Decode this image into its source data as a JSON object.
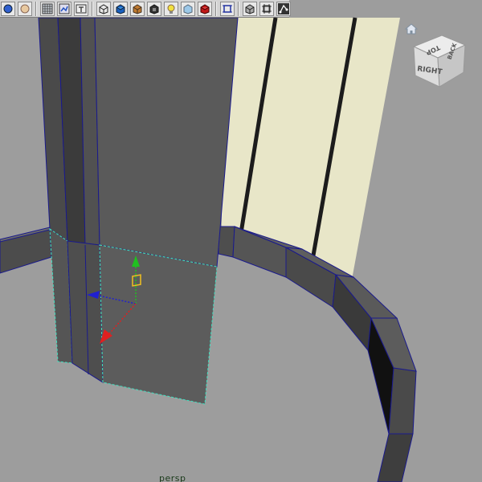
{
  "toolbar": {
    "buttons": [
      {
        "id": "select-mode",
        "icon": "select-mode-icon"
      },
      {
        "id": "snap-mode",
        "icon": "snap-circle-icon"
      },
      {
        "id": "wireframe-grid",
        "icon": "grid-icon"
      },
      {
        "id": "image-plane",
        "icon": "image-plane-icon"
      },
      {
        "id": "text-camera",
        "icon": "camera-attributes-icon"
      },
      {
        "id": "wireframe-shading",
        "icon": "wireframe-cube-icon"
      },
      {
        "id": "smooth-shading",
        "icon": "smooth-shade-icon"
      },
      {
        "id": "textured-shading",
        "icon": "textured-cube-icon"
      },
      {
        "id": "x-ray",
        "icon": "xray-icon"
      },
      {
        "id": "use-all-lights",
        "icon": "light-bulb-icon"
      },
      {
        "id": "shadows",
        "icon": "shadow-cube-icon"
      },
      {
        "id": "screen-space-ao",
        "icon": "red-cube-icon"
      },
      {
        "id": "isolate-select",
        "icon": "isolate-select-icon"
      },
      {
        "id": "xray-joints",
        "icon": "xray-joints-icon"
      },
      {
        "id": "resolution-gate",
        "icon": "resolution-gate-icon"
      },
      {
        "id": "component-display",
        "icon": "component-display-icon"
      }
    ]
  },
  "viewcube": {
    "face_front": "RIGHT",
    "face_top": "TOP",
    "face_side": "BACK"
  },
  "camera_label": "persp",
  "colors": {
    "background": "#9d9d9d",
    "wall": "#e8e6c8",
    "mesh": "#5a5a5a",
    "edge": "#1a1a8c",
    "selection": "#3fe0c0",
    "axis_x": "#e02020",
    "axis_y": "#20c020",
    "axis_z": "#2020d0"
  }
}
